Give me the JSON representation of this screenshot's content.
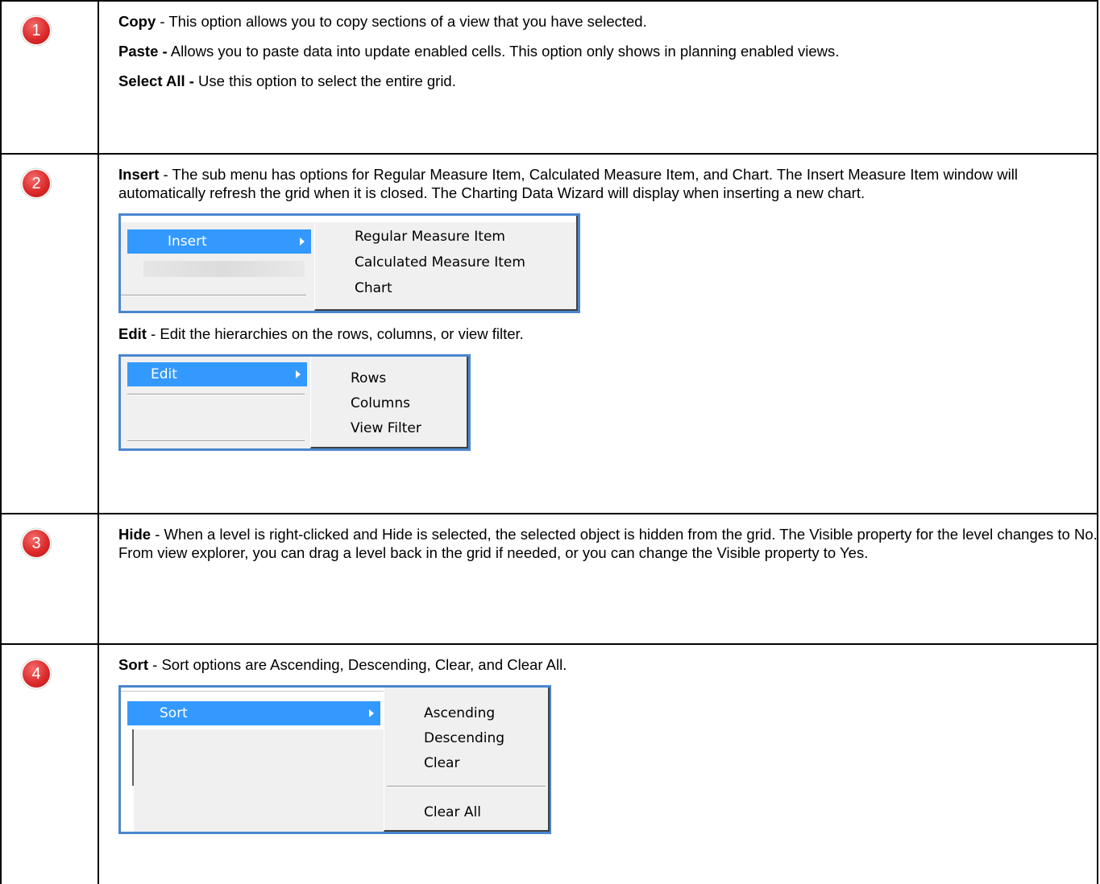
{
  "rows": [
    {
      "number": "1",
      "items": [
        {
          "term": "Copy",
          "text": " - This option allows you to copy sections of a view that you have selected."
        },
        {
          "term": "Paste -",
          "text": " Allows you to paste data into update enabled cells. This option only shows in planning enabled views."
        },
        {
          "term": "Select All -",
          "text": " Use this option to select the entire grid."
        }
      ]
    },
    {
      "number": "2",
      "insert": {
        "term": "Insert",
        "text": " - The sub menu has options for Regular Measure Item, Calculated Measure Item, and Chart. The Insert Measure Item window will automatically refresh the grid when it is closed. The Charting Data Wizard will display when inserting a new chart."
      },
      "insert_menu": {
        "label": "Insert",
        "items": [
          "Regular Measure Item",
          "Calculated Measure Item",
          "Chart"
        ]
      },
      "edit": {
        "term": "Edit",
        "text": " - Edit the hierarchies on the rows, columns, or view filter."
      },
      "edit_menu": {
        "label": "Edit",
        "items": [
          "Rows",
          "Columns",
          "View Filter"
        ]
      }
    },
    {
      "number": "3",
      "hide": {
        "term": "Hide",
        "text": " - When a level is right-clicked and Hide is selected, the selected object is hidden from the grid. The Visible property for the level changes to No. From view explorer, you can drag a level back in the grid if needed, or you can change the Visible property to Yes."
      }
    },
    {
      "number": "4",
      "sort": {
        "term": "Sort",
        "text": " - Sort options are Ascending, Descending, Clear, and Clear All."
      },
      "sort_menu": {
        "label": "Sort",
        "items": [
          "Ascending",
          "Descending",
          "Clear",
          "Clear All"
        ]
      }
    }
  ],
  "colors": {
    "badge": "#dd2b2b",
    "highlight": "#3399ff",
    "frame": "#4a86cf"
  }
}
